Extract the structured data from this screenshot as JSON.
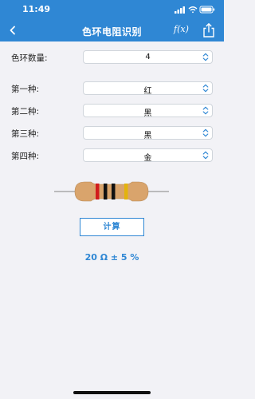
{
  "status_bar": {
    "time": "11:49"
  },
  "nav": {
    "title": "色环电阻识别",
    "formula_label": "f(x)"
  },
  "form": {
    "band_count": {
      "label": "色环数量:",
      "value": "4"
    },
    "bands": [
      {
        "label": "第一种:",
        "value": "红"
      },
      {
        "label": "第二种:",
        "value": "黑"
      },
      {
        "label": "第三种:",
        "value": "黑"
      },
      {
        "label": "第四种:",
        "value": "金"
      }
    ]
  },
  "resistor": {
    "body_color": "#d9a46c",
    "band_colors": [
      "#d11c1c",
      "#111111",
      "#111111",
      "#e3b30d"
    ]
  },
  "calc_button": {
    "label": "计算"
  },
  "result": {
    "text": "20 Ω ± 5 %"
  },
  "colors": {
    "accent": "#2f87d4"
  }
}
